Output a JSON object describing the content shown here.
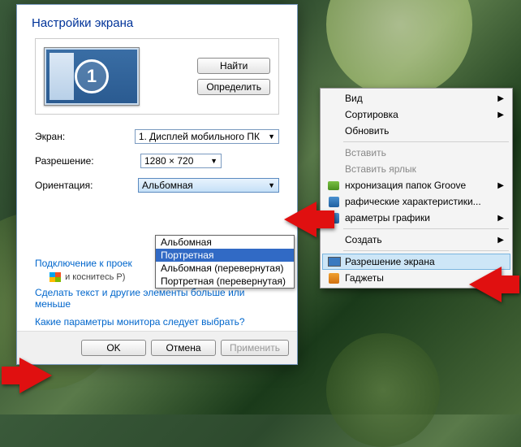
{
  "dialog": {
    "title": "Настройки экрана",
    "monitor_number": "1",
    "detect_btn": "Найти",
    "identify_btn": "Определить",
    "screen_label": "Экран:",
    "screen_value": "1. Дисплей мобильного ПК",
    "resolution_label": "Разрешение:",
    "resolution_value": "1280 × 720",
    "orientation_label": "Ориентация:",
    "orientation_value": "Альбомная",
    "orientation_options": [
      "Альбомная",
      "Портретная",
      "Альбомная (перевернутая)",
      "Портретная (перевернутая)"
    ],
    "projector_link": "Подключение к проек",
    "projector_hint": "и коснитесь P)",
    "text_size_link": "Сделать текст и другие элементы больше или меньше",
    "which_settings_link": "Какие параметры монитора следует выбрать?",
    "ok": "OK",
    "cancel": "Отмена",
    "apply": "Применить"
  },
  "context_menu": {
    "view": "Вид",
    "sort": "Сортировка",
    "refresh": "Обновить",
    "paste": "Вставить",
    "paste_shortcut": "Вставить ярлык",
    "groove_sync": "нхронизация папок Groove",
    "gfx_props": "рафические характеристики...",
    "gfx_params": "араметры графики",
    "create": "Создать",
    "screen_res": "Разрешение экрана",
    "gadgets": "Гаджеты"
  }
}
